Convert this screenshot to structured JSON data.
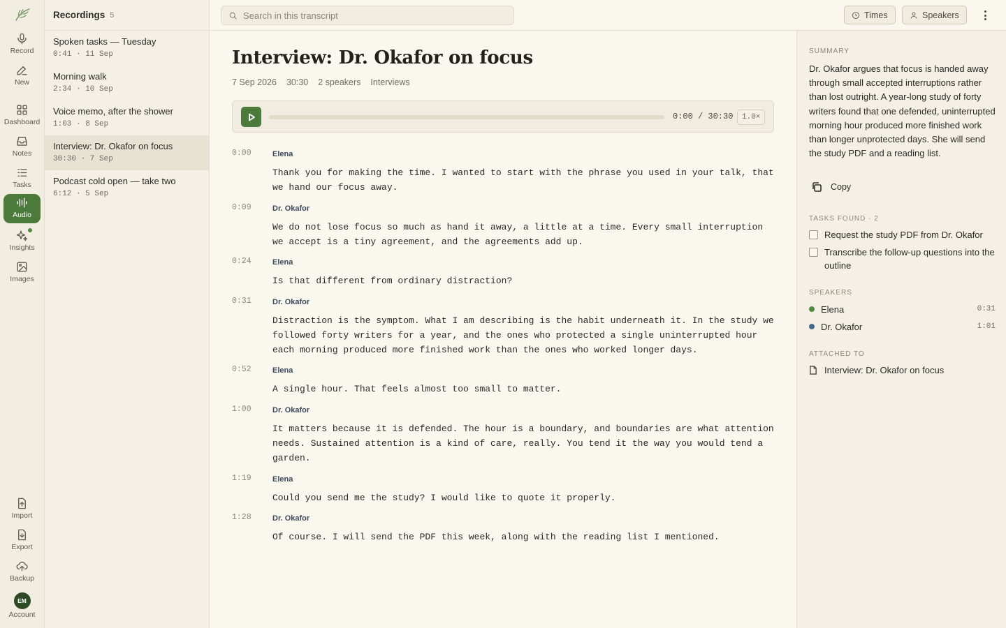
{
  "rail": {
    "items": [
      {
        "label": "Record",
        "icon": "microphone-icon"
      },
      {
        "label": "New",
        "icon": "pencil-icon"
      },
      {
        "label": "Dashboard",
        "icon": "dashboard-grid-icon"
      },
      {
        "label": "Notes",
        "icon": "inbox-icon"
      },
      {
        "label": "Tasks",
        "icon": "task-list-icon"
      },
      {
        "label": "Audio",
        "icon": "waveform-icon"
      },
      {
        "label": "Insights",
        "icon": "sparkle-icon"
      },
      {
        "label": "Images",
        "icon": "image-icon"
      }
    ],
    "bottom": [
      {
        "label": "Import",
        "icon": "file-import-icon"
      },
      {
        "label": "Export",
        "icon": "file-export-icon"
      },
      {
        "label": "Backup",
        "icon": "cloud-upload-icon"
      }
    ],
    "account": {
      "initials": "EM",
      "label": "Account"
    },
    "active_color": "#4b7a3b"
  },
  "recordings": {
    "title": "Recordings",
    "count": "5",
    "items": [
      {
        "title": "Spoken tasks — Tuesday",
        "meta": "0:41 · 11 Sep"
      },
      {
        "title": "Morning walk",
        "meta": "2:34 · 10 Sep"
      },
      {
        "title": "Voice memo, after the shower",
        "meta": "1:03 · 8 Sep"
      },
      {
        "title": "Interview: Dr. Okafor on focus",
        "meta": "30:30 · 7 Sep"
      },
      {
        "title": "Podcast cold open — take two",
        "meta": "6:12 · 5 Sep"
      }
    ]
  },
  "topbar": {
    "search_placeholder": "Search in this transcript",
    "times_label": "Times",
    "speakers_label": "Speakers"
  },
  "main": {
    "title": "Interview: Dr. Okafor on focus",
    "date": "7 Sep 2026",
    "duration": "30:30",
    "speakers_count": "2 speakers",
    "folder": "Interviews",
    "player": {
      "time": "0:00 / 30:30",
      "speed": "1.0×",
      "progress": 0
    },
    "segments": [
      {
        "time": "0:00",
        "speaker": "Elena",
        "text": "Thank you for making the time. I wanted to start with the phrase you used in your talk, that we hand our focus away."
      },
      {
        "time": "0:09",
        "speaker": "Dr. Okafor",
        "text": "We do not lose focus so much as hand it away, a little at a time. Every small interruption we accept is a tiny agreement, and the agreements add up."
      },
      {
        "time": "0:24",
        "speaker": "Elena",
        "text": "Is that different from ordinary distraction?"
      },
      {
        "time": "0:31",
        "speaker": "Dr. Okafor",
        "text": "Distraction is the symptom. What I am describing is the habit underneath it. In the study we followed forty writers for a year, and the ones who protected a single uninterrupted hour each morning produced more finished work than the ones who worked longer days."
      },
      {
        "time": "0:52",
        "speaker": "Elena",
        "text": "A single hour. That feels almost too small to matter."
      },
      {
        "time": "1:00",
        "speaker": "Dr. Okafor",
        "text": "It matters because it is defended. The hour is a boundary, and boundaries are what attention needs. Sustained attention is a kind of care, really. You tend it the way you would tend a garden."
      },
      {
        "time": "1:19",
        "speaker": "Elena",
        "text": "Could you send me the study? I would like to quote it properly."
      },
      {
        "time": "1:28",
        "speaker": "Dr. Okafor",
        "text": "Of course. I will send the PDF this week, along with the reading list I mentioned."
      }
    ]
  },
  "sidebar": {
    "summary_label": "SUMMARY",
    "summary": "Dr. Okafor argues that focus is handed away through small accepted interruptions rather than lost outright. A year-long study of forty writers found that one defended, uninterrupted morning hour produced more finished work than longer unprotected days. She will send the study PDF and a reading list.",
    "copy_label": "Copy",
    "tasks_label": "TASKS FOUND · 2",
    "tasks": [
      {
        "text": "Request the study PDF from Dr. Okafor"
      },
      {
        "text": "Transcribe the follow-up questions into the outline"
      }
    ],
    "speakers_label": "SPEAKERS",
    "speakers": [
      {
        "name": "Elena",
        "time": "0:31",
        "color": "#4e8a3f"
      },
      {
        "name": "Dr. Okafor",
        "time": "1:01",
        "color": "#4a6a8c"
      }
    ],
    "attached_label": "ATTACHED TO",
    "attached": "Interview: Dr. Okafor on focus"
  }
}
